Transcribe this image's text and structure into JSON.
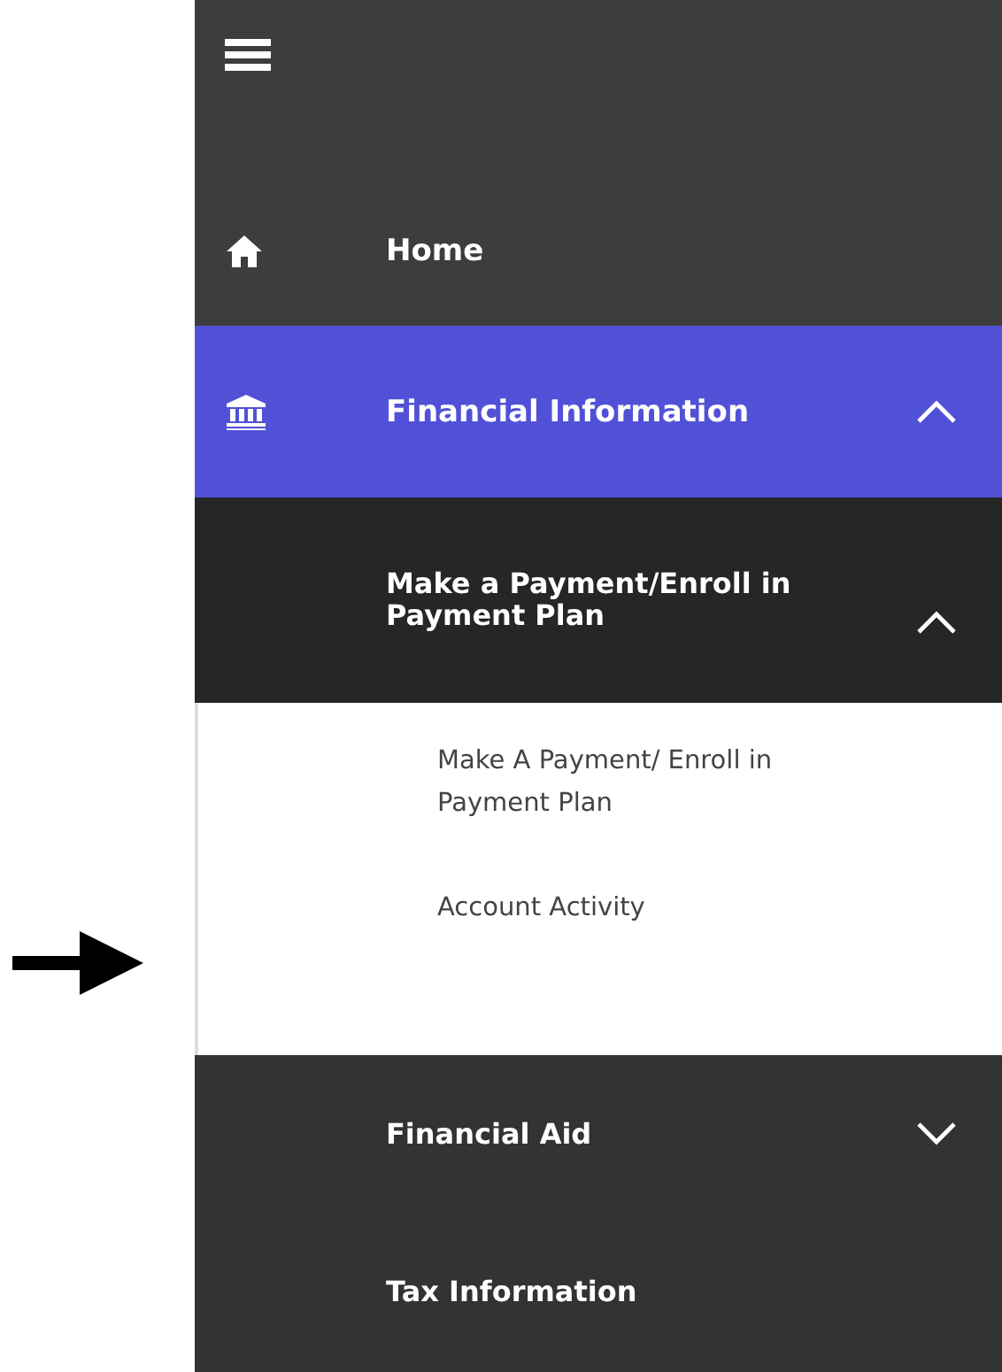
{
  "nav": [
    {
      "label": "Home",
      "selected": false
    },
    {
      "label": "Financial Information",
      "selected": true,
      "expanded": true,
      "children": [
        {
          "label": "Make a Payment/Enroll in Payment Plan",
          "expanded": true,
          "children": [
            {
              "label": "Make A Payment/ Enroll in Payment Plan"
            },
            {
              "label": "Account Activity"
            }
          ]
        },
        {
          "label": "Financial Aid",
          "expanded": false
        },
        {
          "label": "Tax Information"
        }
      ]
    }
  ]
}
